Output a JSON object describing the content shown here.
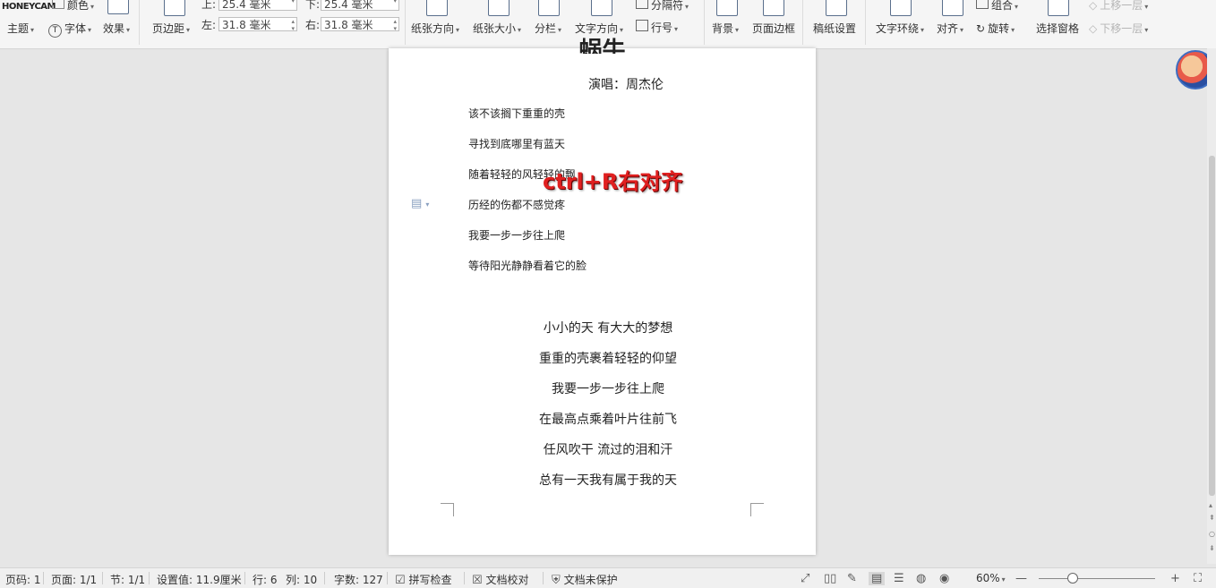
{
  "ribbon": {
    "watermark": "HONEYCAM",
    "theme": "主题",
    "color": "颜色",
    "font": "字体",
    "effect": "效果",
    "margins": "页边距",
    "top_label": "上:",
    "top_value": "25.4 毫米",
    "bottom_label": "下:",
    "bottom_value": "25.4 毫米",
    "left_label": "左:",
    "left_value": "31.8 毫米",
    "right_label": "右:",
    "right_value": "31.8 毫米",
    "orientation": "纸张方向",
    "size": "纸张大小",
    "columns": "分栏",
    "text_direction": "文字方向",
    "breaks": "分隔符",
    "line_numbers": "行号",
    "background": "背景",
    "page_border": "页面边框",
    "manuscript": "稿纸设置",
    "wrap_text": "文字环绕",
    "align": "对齐",
    "group": "组合",
    "rotate": "旋转",
    "selection_pane": "选择窗格",
    "bring_forward": "上移一层",
    "send_backward": "下移一层"
  },
  "doc": {
    "title": "蜗牛",
    "singer": "演唱：周杰伦",
    "verse1": [
      "该不该搁下重重的壳",
      "寻找到底哪里有蓝天",
      "随着轻轻的风轻轻的飘",
      "历经的伤都不感觉疼",
      "我要一步一步往上爬",
      "等待阳光静静看着它的脸"
    ],
    "verse2": [
      "小小的天  有大大的梦想",
      "重重的壳裹着轻轻的仰望",
      "我要一步一步往上爬",
      "在最高点乘着叶片往前飞",
      "任风吹干  流过的泪和汗",
      "总有一天我有属于我的天"
    ]
  },
  "overlay_text": "ctrl+R右对齐",
  "status": {
    "page_num": "页码: 1",
    "pages": "页面: 1/1",
    "section": "节: 1/1",
    "setting": "设置值: 11.9厘米",
    "row": "行: 6",
    "col": "列: 10",
    "word_count": "字数: 127",
    "spell_check": "拼写检查",
    "doc_proof": "文档校对",
    "unprotected": "文档未保护",
    "zoom": "60%"
  }
}
